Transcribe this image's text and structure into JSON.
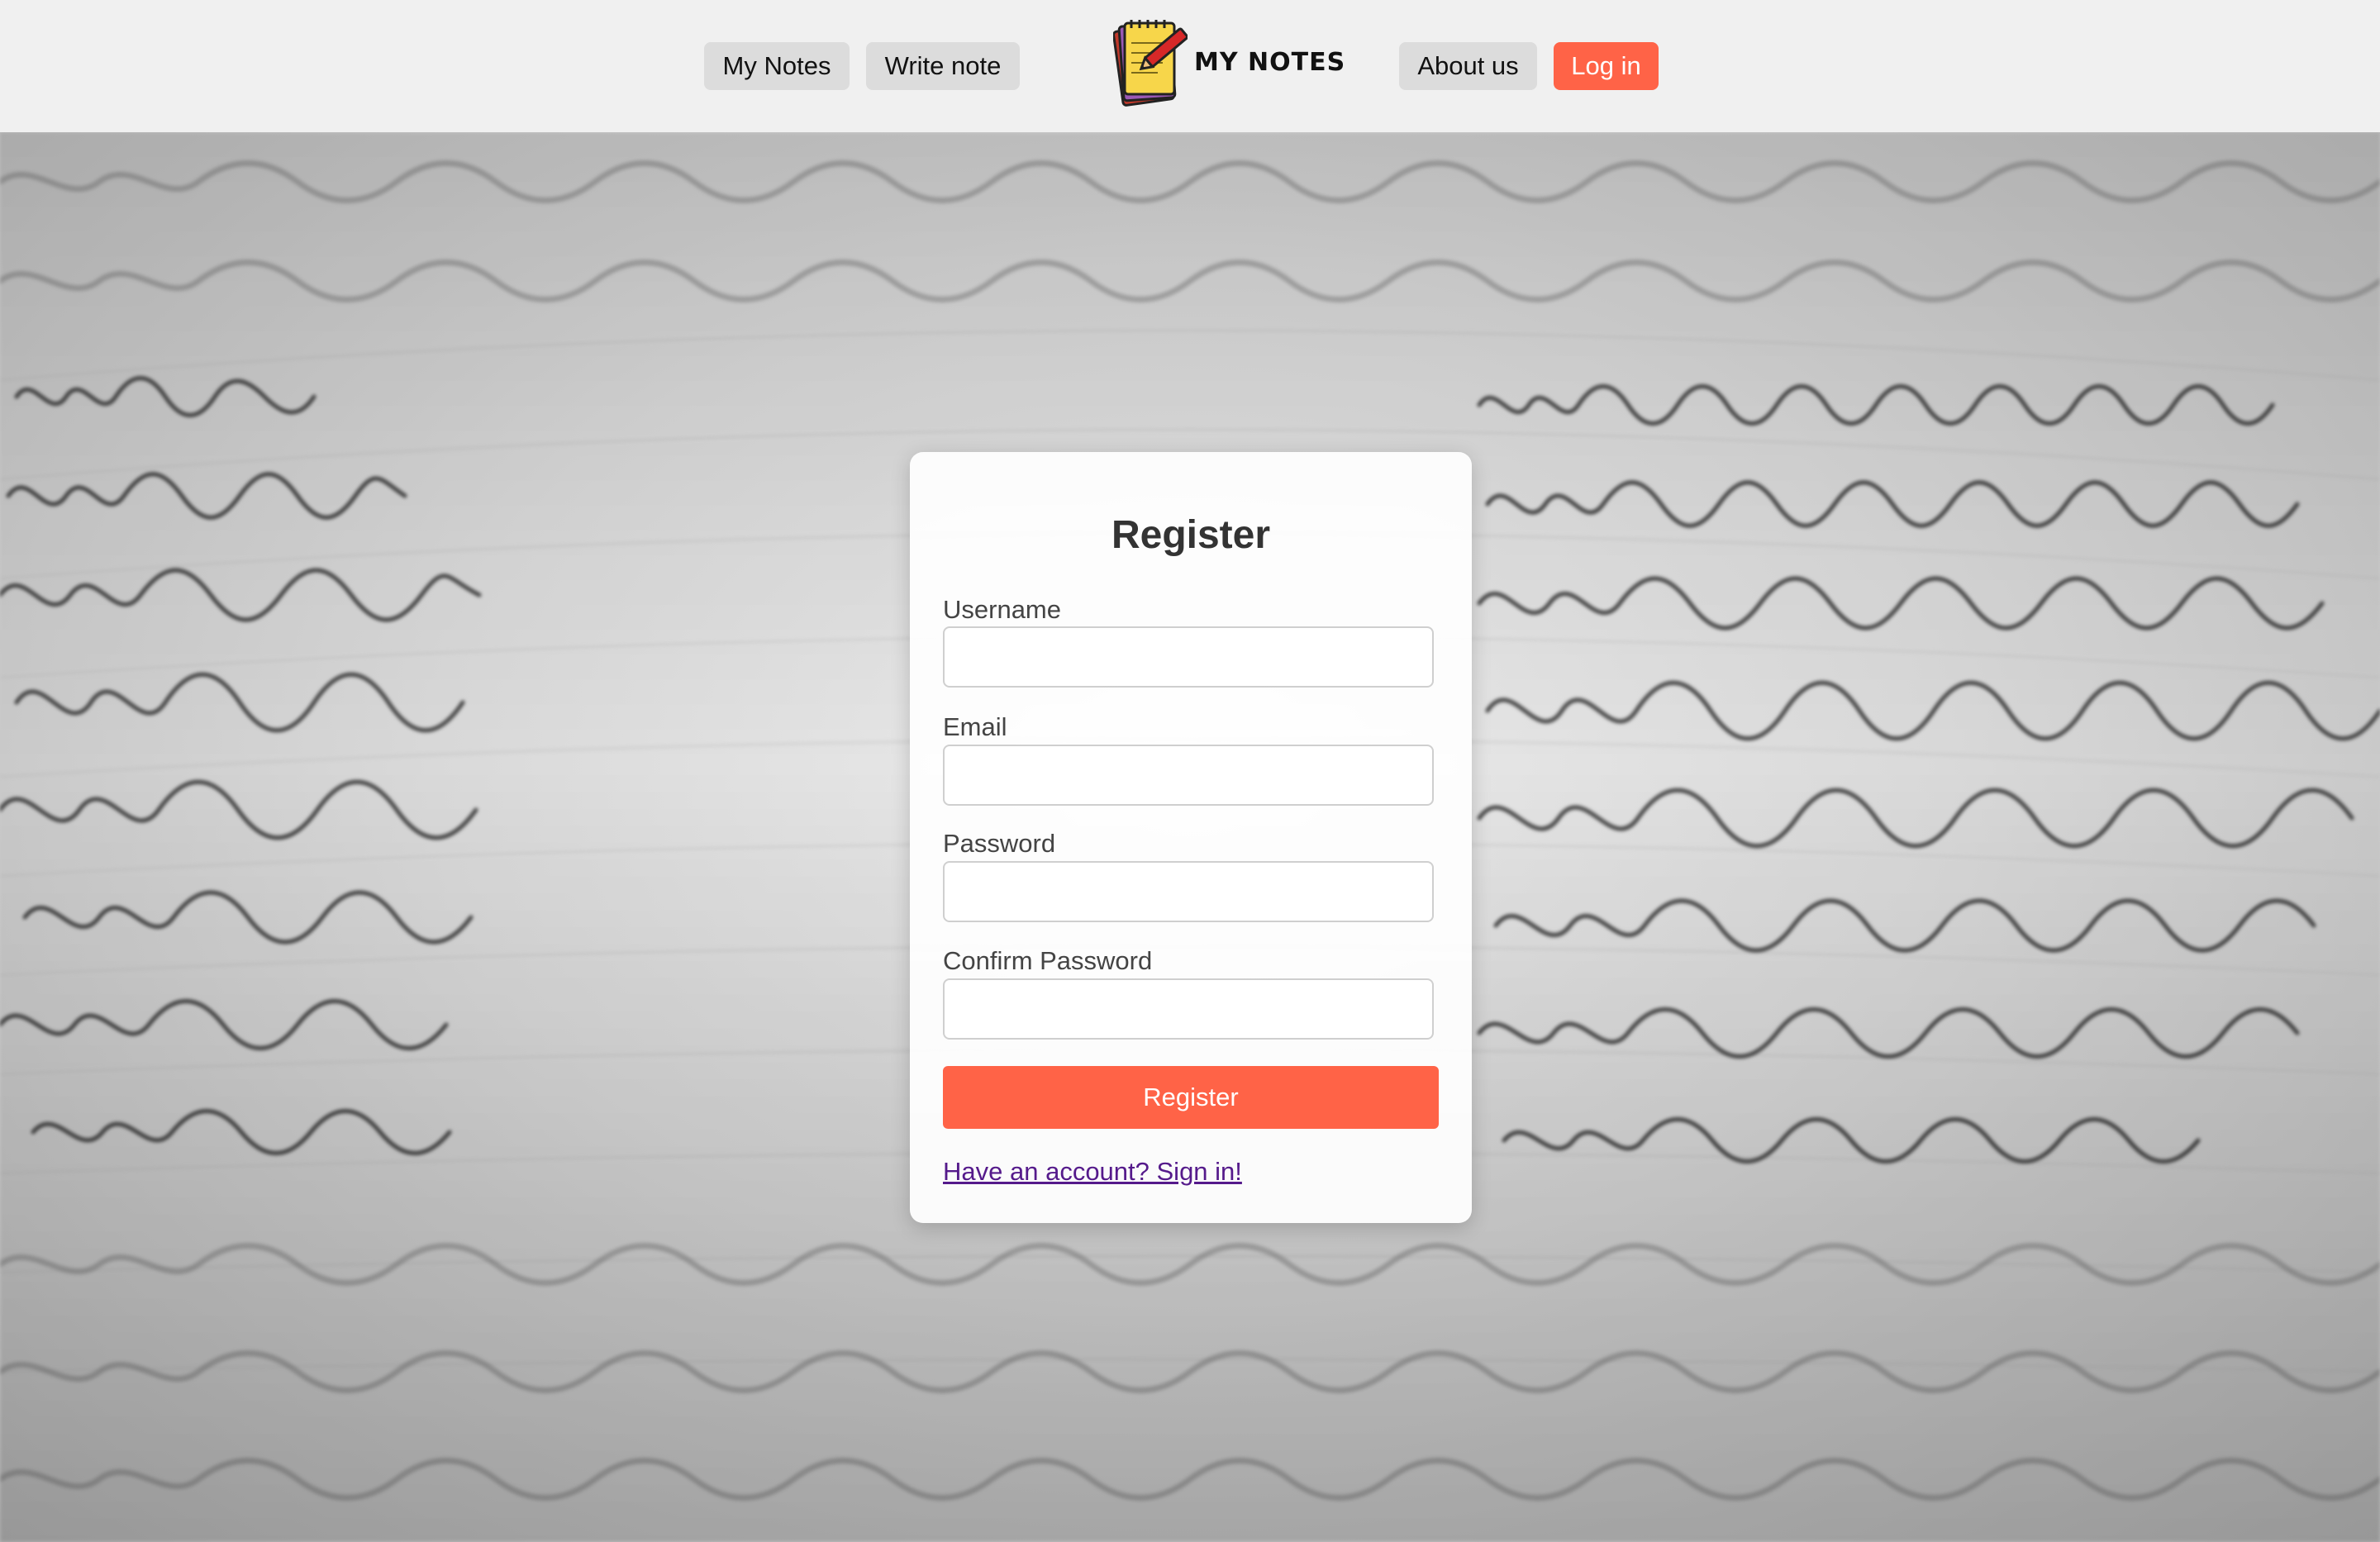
{
  "header": {
    "nav": {
      "my_notes": "My Notes",
      "write_note": "Write note",
      "about_us": "About us",
      "log_in": "Log in"
    },
    "logo_text": "MY NOTES",
    "logo_icon": "notepad-pencil-icon"
  },
  "form": {
    "title": "Register",
    "fields": {
      "username": {
        "label": "Username",
        "value": ""
      },
      "email": {
        "label": "Email",
        "value": ""
      },
      "password": {
        "label": "Password",
        "value": ""
      },
      "confirm_password": {
        "label": "Confirm Password",
        "value": ""
      }
    },
    "submit_label": "Register",
    "signin_link": "Have an account? Sign in!"
  },
  "colors": {
    "accent": "#ff6347",
    "header_bg": "#f0f0f0",
    "nav_button_bg": "#dcdcdc",
    "visited_link": "#551a8b"
  },
  "background": "handwritten-paper-photo"
}
